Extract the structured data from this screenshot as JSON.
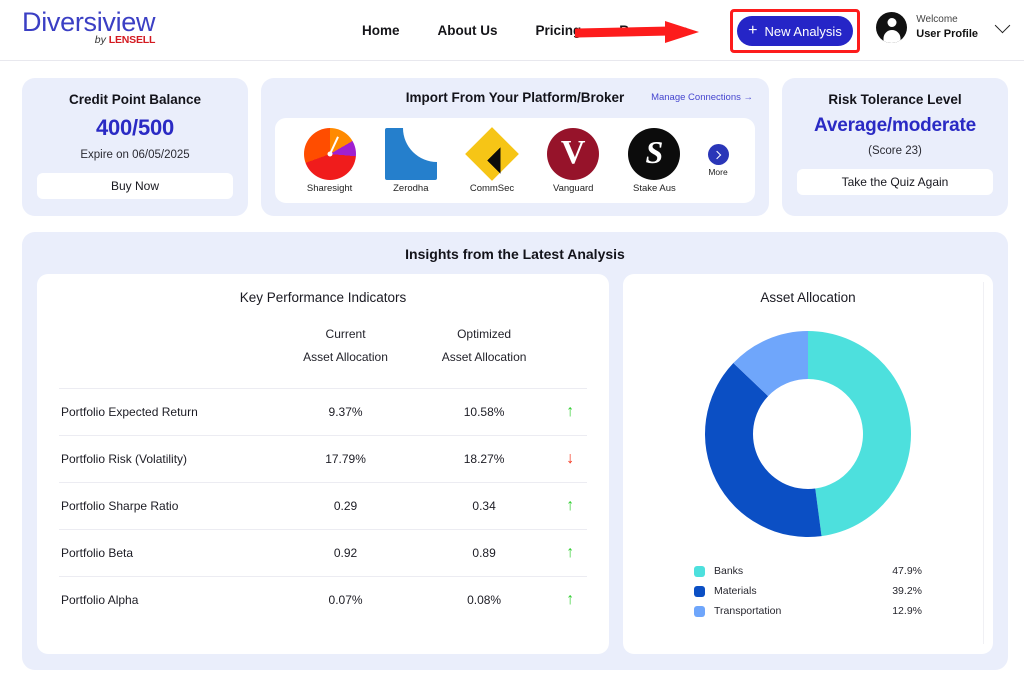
{
  "header": {
    "brand_name": "Diversiview",
    "brand_by": "by",
    "brand_lensell": "LENSELL",
    "nav": [
      {
        "label": "Home"
      },
      {
        "label": "About Us"
      },
      {
        "label": "Pricing"
      },
      {
        "label": "Resources"
      }
    ],
    "new_analysis_label": "New Analysis",
    "new_analysis_plus": "+",
    "profile_welcome": "Welcome",
    "profile_name": "User Profile"
  },
  "credit_card": {
    "title": "Credit Point Balance",
    "value": "400/500",
    "expiry": "Expire on 06/05/2025",
    "button": "Buy Now"
  },
  "import_card": {
    "title": "Import From Your Platform/Broker",
    "manage_link": "Manage Connections →",
    "brokers": [
      {
        "label": "Sharesight",
        "icon": "sharesight-logo"
      },
      {
        "label": "Zerodha",
        "icon": "zerodha-logo"
      },
      {
        "label": "CommSec",
        "icon": "commsec-logo"
      },
      {
        "label": "Vanguard",
        "icon": "vanguard-logo"
      },
      {
        "label": "Stake Aus",
        "icon": "stake-logo"
      }
    ],
    "more_label": "More"
  },
  "risk_card": {
    "title": "Risk Tolerance Level",
    "value": "Average/moderate",
    "score": "(Score 23)",
    "button": "Take the Quiz Again"
  },
  "insights": {
    "title": "Insights from the Latest Analysis",
    "kpi_panel_title": "Key Performance Indicators",
    "alloc_panel_title": "Asset Allocation",
    "kpi_headers": {
      "metric": "",
      "current_line1": "Current",
      "current_line2": "Asset Allocation",
      "optimized_line1": "Optimized",
      "optimized_line2": "Asset Allocation"
    },
    "kpi_rows": [
      {
        "metric": "Portfolio Expected Return",
        "current": "9.37%",
        "optimized": "10.58%",
        "trend": "up"
      },
      {
        "metric": "Portfolio Risk (Volatility)",
        "current": "17.79%",
        "optimized": "18.27%",
        "trend": "down"
      },
      {
        "metric": "Portfolio Sharpe Ratio",
        "current": "0.29",
        "optimized": "0.34",
        "trend": "up"
      },
      {
        "metric": "Portfolio Beta",
        "current": "0.92",
        "optimized": "0.89",
        "trend": "up"
      },
      {
        "metric": "Portfolio Alpha",
        "current": "0.07%",
        "optimized": "0.08%",
        "trend": "up"
      }
    ]
  },
  "chart_data": {
    "type": "pie",
    "title": "Asset Allocation",
    "donut": true,
    "legend_position": "bottom",
    "categories": [
      "Banks",
      "Materials",
      "Transportation"
    ],
    "values": [
      47.9,
      39.2,
      12.9
    ],
    "value_labels": [
      "47.9%",
      "39.2%",
      "12.9%"
    ],
    "colors": [
      "#4de0dd",
      "#0b4fc4",
      "#6fa6fb"
    ]
  },
  "colors": {
    "brand_blue": "#3b3fc4",
    "accent_blue": "#2525c7",
    "card_lavender": "#eaeefb",
    "annotation_red": "#fd1c1c",
    "trend_up": "#34cf34",
    "trend_down": "#f4321a"
  }
}
